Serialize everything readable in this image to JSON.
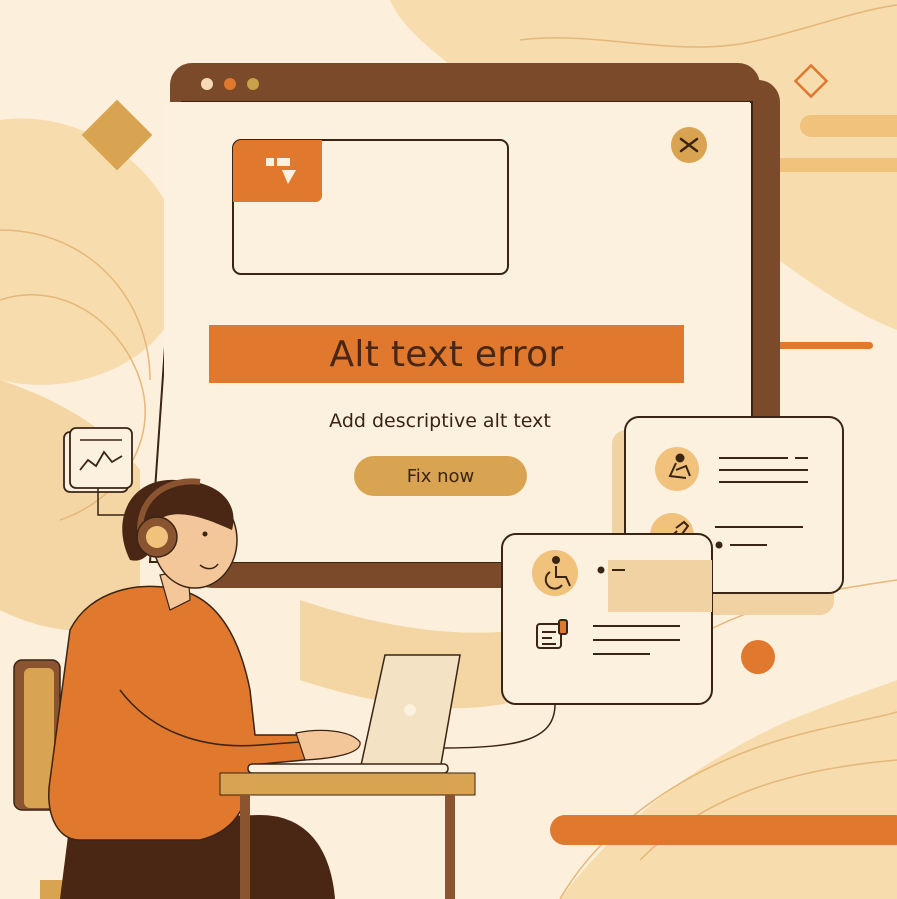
{
  "dialog": {
    "title": "Alt text error",
    "message": "Add descriptive alt text",
    "fix_button_label": "Fix now"
  },
  "colors": {
    "background": "#fcefdb",
    "accent_orange": "#e0782e",
    "window_frame": "#7a4a2b",
    "button_gold": "#d9a452",
    "panel_cream": "#fbf1de",
    "text_dark": "#3a2414"
  },
  "icons": {
    "window_controls": [
      "red-dot",
      "orange-dot",
      "yellow-dot"
    ],
    "close": "close-x-icon",
    "logo": "brand-logo-icon",
    "card_right": [
      "person-kneeling-icon",
      "tools-icon"
    ],
    "card_left": [
      "wheelchair-icon",
      "document-icon"
    ],
    "side_graph": "line-graph-icon"
  }
}
